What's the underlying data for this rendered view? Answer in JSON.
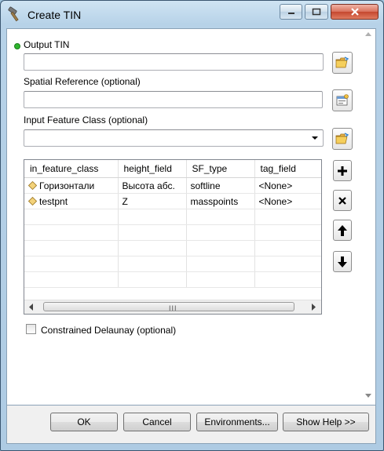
{
  "window": {
    "title": "Create TIN"
  },
  "output_tin": {
    "label": "Output TIN",
    "value": ""
  },
  "spatial_reference": {
    "label": "Spatial Reference (optional)",
    "value": ""
  },
  "input_feature_class": {
    "label": "Input Feature Class (optional)",
    "value": ""
  },
  "table": {
    "columns": [
      "in_feature_class",
      "height_field",
      "SF_type",
      "tag_field"
    ],
    "rows": [
      [
        "Горизонтали",
        "Высота абс.",
        "softline",
        "<None>"
      ],
      [
        "testpnt",
        "Z",
        "masspoints",
        "<None>"
      ]
    ],
    "scroll_grip": "III"
  },
  "constrained_delaunay": {
    "label": "Constrained Delaunay (optional)",
    "checked": false
  },
  "buttons": {
    "ok": "OK",
    "cancel": "Cancel",
    "environments": "Environments...",
    "show_help": "Show Help >>"
  },
  "icons": {
    "required_dot_color": "#2fb52f",
    "folder": "open-folder-icon"
  }
}
